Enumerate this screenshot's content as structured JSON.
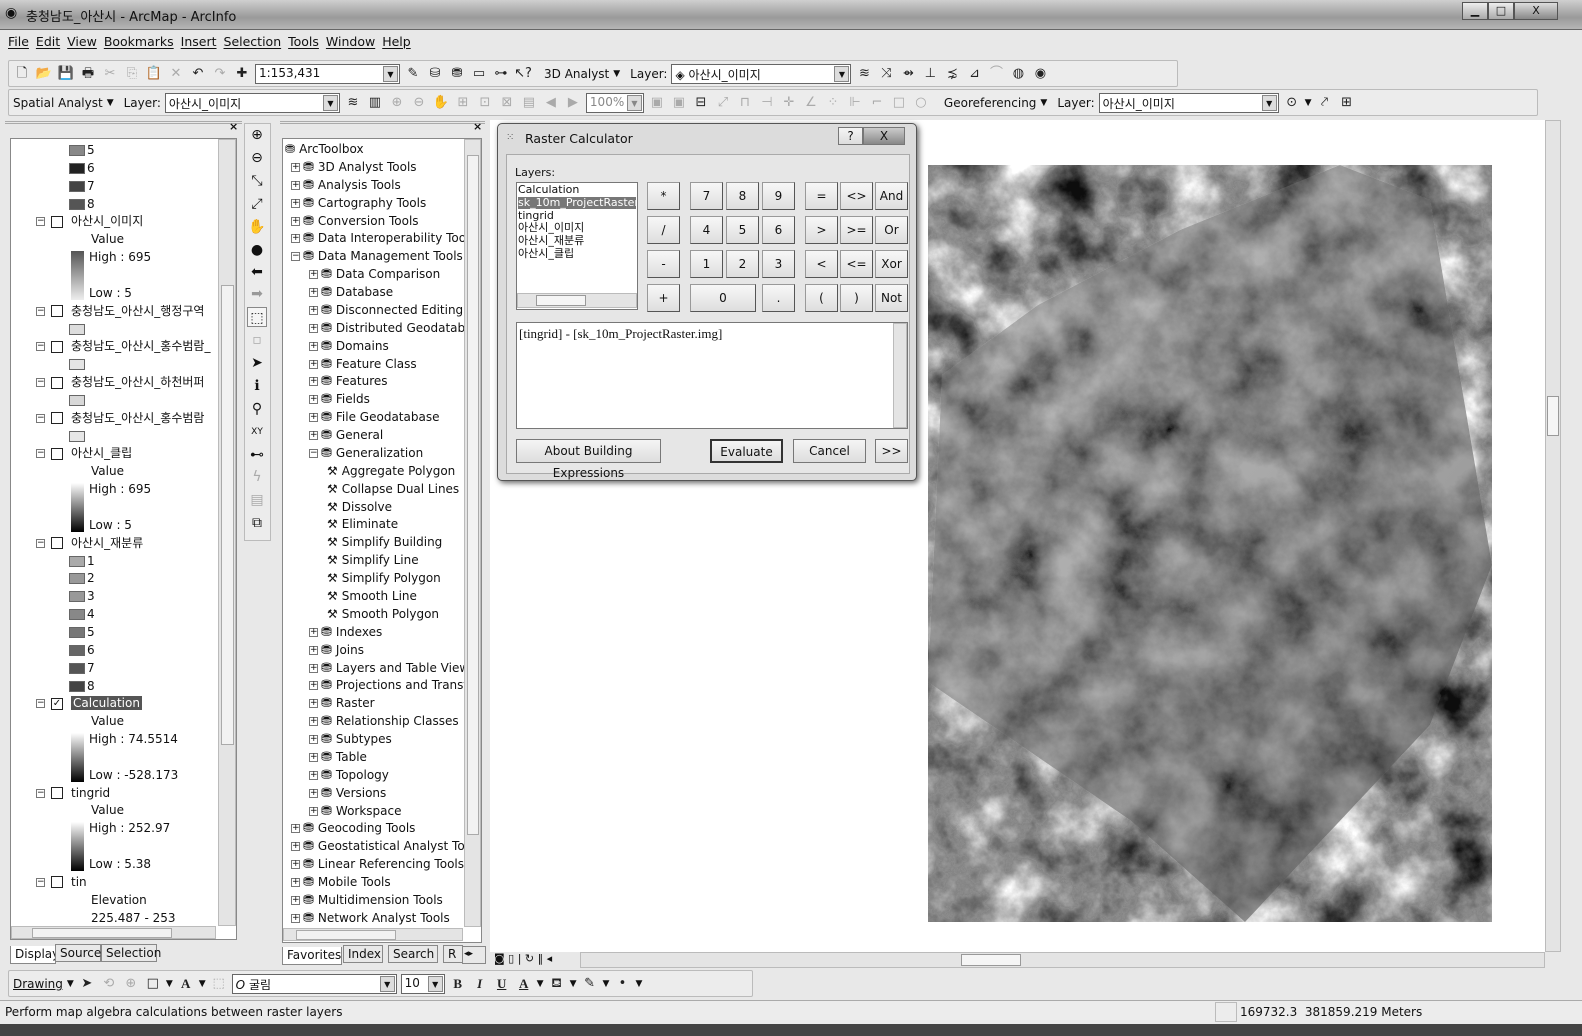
{
  "window": {
    "title": "충청남도_아산시 - ArcMap - ArcInfo",
    "min": "▁",
    "max": "□",
    "close": "X"
  },
  "menu": [
    "File",
    "Edit",
    "View",
    "Bookmarks",
    "Insert",
    "Selection",
    "Tools",
    "Window",
    "Help"
  ],
  "toolbar1": {
    "scale": "1:153,431",
    "analyst_3d": "3D Analyst",
    "layer_label": "Layer:",
    "layer_value": "아산시_이미지"
  },
  "toolbar2": {
    "spatial_analyst": "Spatial Analyst",
    "layer_label": "Layer:",
    "layer_value": "아산시_이미지",
    "zoom": "100%",
    "georeferencing": "Georeferencing",
    "geo_layer_label": "Layer:",
    "geo_layer_value": "아산시_이미지"
  },
  "toc": {
    "rows": [
      {
        "t": "sw",
        "label": "5",
        "color": "#888888"
      },
      {
        "t": "sw",
        "label": "6",
        "color": "#222222"
      },
      {
        "t": "sw",
        "label": "7",
        "color": "#444444"
      },
      {
        "t": "sw",
        "label": "8",
        "color": "#555555"
      },
      {
        "t": "layer",
        "label": "아산시_이미지",
        "checked": false
      },
      {
        "t": "sub",
        "label": "Value"
      },
      {
        "t": "grad",
        "label": "High : 695",
        "dir": "dark-top"
      },
      {
        "t": "blank"
      },
      {
        "t": "low",
        "label": "Low : 5"
      },
      {
        "t": "layer",
        "label": "충청남도_아산시_행정구역",
        "checked": false
      },
      {
        "t": "sw",
        "label": "",
        "color": "#dddddd"
      },
      {
        "t": "layer",
        "label": "충청남도_아산시_홍수범람_",
        "checked": false
      },
      {
        "t": "sw",
        "label": "",
        "color": "#e4e4e4"
      },
      {
        "t": "layer",
        "label": "충청남도_아산시_하천버퍼",
        "checked": false
      },
      {
        "t": "sw",
        "label": "",
        "color": "#d8d8d8"
      },
      {
        "t": "layer",
        "label": "충청남도_아산시_홍수범람",
        "checked": false
      },
      {
        "t": "sw",
        "label": "",
        "color": "#e6e6e6"
      },
      {
        "t": "layer",
        "label": "아산시_클립",
        "checked": false
      },
      {
        "t": "sub",
        "label": "Value"
      },
      {
        "t": "grad",
        "label": "High : 695",
        "dir": "light-top"
      },
      {
        "t": "blank"
      },
      {
        "t": "low",
        "label": "Low : 5"
      },
      {
        "t": "layer",
        "label": "아산시_재분류",
        "checked": false
      },
      {
        "t": "sw",
        "label": "1",
        "color": "#aaaaaa"
      },
      {
        "t": "sw",
        "label": "2",
        "color": "#999999"
      },
      {
        "t": "sw",
        "label": "3",
        "color": "#999999"
      },
      {
        "t": "sw",
        "label": "4",
        "color": "#888888"
      },
      {
        "t": "sw",
        "label": "5",
        "color": "#777777"
      },
      {
        "t": "sw",
        "label": "6",
        "color": "#666666"
      },
      {
        "t": "sw",
        "label": "7",
        "color": "#555555"
      },
      {
        "t": "sw",
        "label": "8",
        "color": "#444444"
      },
      {
        "t": "layer",
        "label": "Calculation",
        "checked": true,
        "selected": true
      },
      {
        "t": "sub",
        "label": "Value"
      },
      {
        "t": "grad",
        "label": "High : 74.5514",
        "dir": "light-top"
      },
      {
        "t": "blank"
      },
      {
        "t": "low",
        "label": "Low : -528.173"
      },
      {
        "t": "layer",
        "label": "tingrid",
        "checked": false
      },
      {
        "t": "sub",
        "label": "Value"
      },
      {
        "t": "grad",
        "label": "High : 252.97",
        "dir": "light-top"
      },
      {
        "t": "blank"
      },
      {
        "t": "low",
        "label": "Low : 5.38"
      },
      {
        "t": "layer",
        "label": "tin",
        "checked": false
      },
      {
        "t": "sub",
        "label": "Elevation"
      },
      {
        "t": "sub",
        "label": "225.487 - 253"
      }
    ],
    "tabs": [
      "Display",
      "Source",
      "Selection"
    ]
  },
  "toolbox": {
    "root": "ArcToolbox",
    "rows": [
      {
        "d": 1,
        "k": "box",
        "label": "3D Analyst Tools"
      },
      {
        "d": 1,
        "k": "box",
        "label": "Analysis Tools"
      },
      {
        "d": 1,
        "k": "box",
        "label": "Cartography Tools"
      },
      {
        "d": 1,
        "k": "box",
        "label": "Conversion Tools"
      },
      {
        "d": 1,
        "k": "box",
        "label": "Data Interoperability Tools"
      },
      {
        "d": 1,
        "k": "box",
        "label": "Data Management Tools",
        "open": true
      },
      {
        "d": 2,
        "k": "box",
        "label": "Data Comparison"
      },
      {
        "d": 2,
        "k": "box",
        "label": "Database"
      },
      {
        "d": 2,
        "k": "box",
        "label": "Disconnected Editing"
      },
      {
        "d": 2,
        "k": "box",
        "label": "Distributed Geodatabase"
      },
      {
        "d": 2,
        "k": "box",
        "label": "Domains"
      },
      {
        "d": 2,
        "k": "box",
        "label": "Feature Class"
      },
      {
        "d": 2,
        "k": "box",
        "label": "Features"
      },
      {
        "d": 2,
        "k": "box",
        "label": "Fields"
      },
      {
        "d": 2,
        "k": "box",
        "label": "File Geodatabase"
      },
      {
        "d": 2,
        "k": "box",
        "label": "General"
      },
      {
        "d": 2,
        "k": "box",
        "label": "Generalization",
        "open": true
      },
      {
        "d": 3,
        "k": "tool",
        "label": "Aggregate Polygon"
      },
      {
        "d": 3,
        "k": "tool",
        "label": "Collapse Dual Lines"
      },
      {
        "d": 3,
        "k": "tool",
        "label": "Dissolve"
      },
      {
        "d": 3,
        "k": "tool",
        "label": "Eliminate"
      },
      {
        "d": 3,
        "k": "tool",
        "label": "Simplify Building"
      },
      {
        "d": 3,
        "k": "tool",
        "label": "Simplify Line"
      },
      {
        "d": 3,
        "k": "tool",
        "label": "Simplify Polygon"
      },
      {
        "d": 3,
        "k": "tool",
        "label": "Smooth Line"
      },
      {
        "d": 3,
        "k": "tool",
        "label": "Smooth Polygon"
      },
      {
        "d": 2,
        "k": "box",
        "label": "Indexes"
      },
      {
        "d": 2,
        "k": "box",
        "label": "Joins"
      },
      {
        "d": 2,
        "k": "box",
        "label": "Layers and Table Views"
      },
      {
        "d": 2,
        "k": "box",
        "label": "Projections and Transformations"
      },
      {
        "d": 2,
        "k": "box",
        "label": "Raster"
      },
      {
        "d": 2,
        "k": "box",
        "label": "Relationship Classes"
      },
      {
        "d": 2,
        "k": "box",
        "label": "Subtypes"
      },
      {
        "d": 2,
        "k": "box",
        "label": "Table"
      },
      {
        "d": 2,
        "k": "box",
        "label": "Topology"
      },
      {
        "d": 2,
        "k": "box",
        "label": "Versions"
      },
      {
        "d": 2,
        "k": "box",
        "label": "Workspace"
      },
      {
        "d": 1,
        "k": "box",
        "label": "Geocoding Tools"
      },
      {
        "d": 1,
        "k": "box",
        "label": "Geostatistical Analyst Tools"
      },
      {
        "d": 1,
        "k": "box",
        "label": "Linear Referencing Tools"
      },
      {
        "d": 1,
        "k": "box",
        "label": "Mobile Tools"
      },
      {
        "d": 1,
        "k": "box",
        "label": "Multidimension Tools"
      },
      {
        "d": 1,
        "k": "box",
        "label": "Network Analyst Tools"
      }
    ],
    "tabs": [
      "Favorites",
      "Index",
      "Search",
      "R"
    ]
  },
  "dialog": {
    "title": "Raster Calculator",
    "help": "?",
    "close": "X",
    "layers_label": "Layers:",
    "layers": [
      "Calculation",
      "sk_10m_ProjectRaster.img",
      "tingrid",
      "아산시_이미지",
      "아산시_재분류",
      "아산시_클립"
    ],
    "selected_layer": "sk_10m_ProjectRaster.img",
    "keys": [
      [
        "*",
        "7",
        "8",
        "9",
        "=",
        "<>",
        "And"
      ],
      [
        "/",
        "4",
        "5",
        "6",
        ">",
        ">=",
        "Or"
      ],
      [
        "-",
        "1",
        "2",
        "3",
        "<",
        "<=",
        "Xor"
      ],
      [
        "+",
        "0",
        ".",
        "(",
        ")",
        "Not"
      ]
    ],
    "expression": "[tingrid] - [sk_10m_ProjectRaster.img]",
    "about": "About Building Expressions",
    "evaluate": "Evaluate",
    "cancel": "Cancel",
    "more": ">>"
  },
  "drawing": {
    "label": "Drawing",
    "font": "굴림",
    "size": "10",
    "bold": "B",
    "italic": "I",
    "underline": "U"
  },
  "status": {
    "message": "Perform map algebra calculations between raster layers",
    "coords": "169732.3  381859.219 Meters"
  }
}
